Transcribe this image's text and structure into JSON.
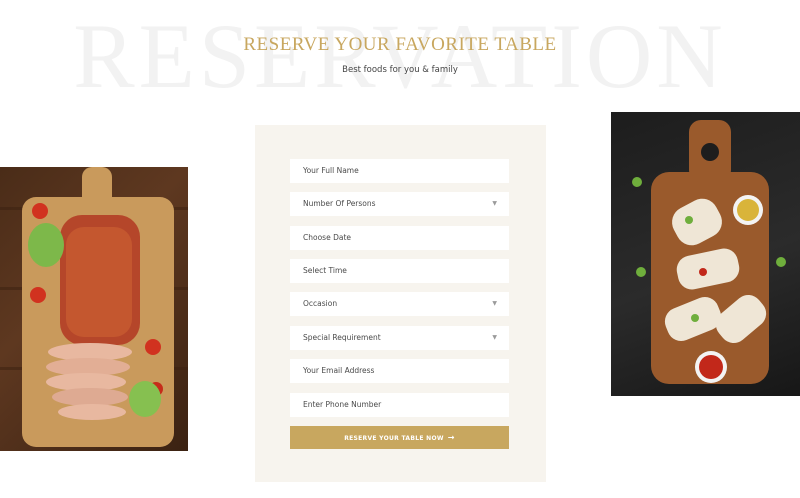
{
  "header": {
    "background_word": "RESERVATION",
    "title": "RESERVE YOUR FAVORITE TABLE",
    "subtitle": "Best foods for you & family"
  },
  "form": {
    "fields": [
      {
        "placeholder": "Your Full Name",
        "type": "text"
      },
      {
        "placeholder": "Number Of Persons",
        "type": "select",
        "icon": "chevron-down-icon"
      },
      {
        "placeholder": "Choose Date",
        "type": "date"
      },
      {
        "placeholder": "Select Time",
        "type": "time"
      },
      {
        "placeholder": "Occasion",
        "type": "select",
        "icon": "chevron-down-icon"
      },
      {
        "placeholder": "Special Requirement",
        "type": "select",
        "icon": "chevron-down-icon"
      },
      {
        "placeholder": "Your Email Address",
        "type": "email"
      },
      {
        "placeholder": "Enter Phone Number",
        "type": "tel"
      }
    ],
    "submit_label": "RESERVE YOUR TABLE NOW",
    "submit_icon": "arrow-right-icon"
  },
  "colors": {
    "accent": "#c8a75f",
    "card_background": "#f7f4ee",
    "watermark": "#f2f2f2"
  }
}
